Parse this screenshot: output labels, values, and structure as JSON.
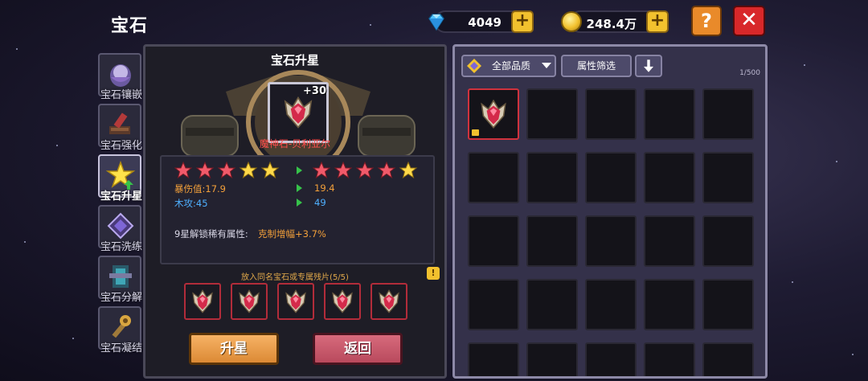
{
  "header": {
    "title": "宝石"
  },
  "currency": {
    "diamond": "4049",
    "gold": "248.4万"
  },
  "top_buttons": {
    "help": "?",
    "close": "✕",
    "plus": "+"
  },
  "tabs": [
    {
      "label": "宝石镶嵌",
      "icon": "gem-socket-icon"
    },
    {
      "label": "宝石强化",
      "icon": "gem-forge-icon"
    },
    {
      "label": "宝石升星",
      "icon": "star-up-icon",
      "active": true
    },
    {
      "label": "宝石洗练",
      "icon": "gem-refine-icon"
    },
    {
      "label": "宝石分解",
      "icon": "gem-decompose-icon"
    },
    {
      "label": "宝石凝结",
      "icon": "gem-condense-icon"
    }
  ],
  "upgrade": {
    "title": "宝石升星",
    "level": "+30",
    "gem_name": "魔神石-贝利亚尔",
    "current_stars": {
      "red": 3,
      "gold": 2
    },
    "next_stars": {
      "red": 4,
      "gold": 1
    },
    "stats": [
      {
        "label": "暴伤值:17.9",
        "next": "19.4",
        "color": "orange"
      },
      {
        "label": "木攻:45",
        "next": "49",
        "color": "blue"
      }
    ],
    "unlock_text": "9星解锁稀有属性:",
    "unlock_value": "克制增幅+3.7%",
    "material_hint": "放入同名宝石或专属残片(5/5)",
    "info": "!",
    "materials_count": 5,
    "btn_upgrade": "升星",
    "btn_back": "返回"
  },
  "inventory": {
    "filter_quality": "全部品质",
    "filter_attr": "属性筛选",
    "count": "1/500",
    "rows": 5,
    "cols": 5,
    "filled_slots": 1
  },
  "colors": {
    "accent_orange": "#e98a2a",
    "close_red": "#d8282a",
    "gem_red": "#d0323d"
  }
}
